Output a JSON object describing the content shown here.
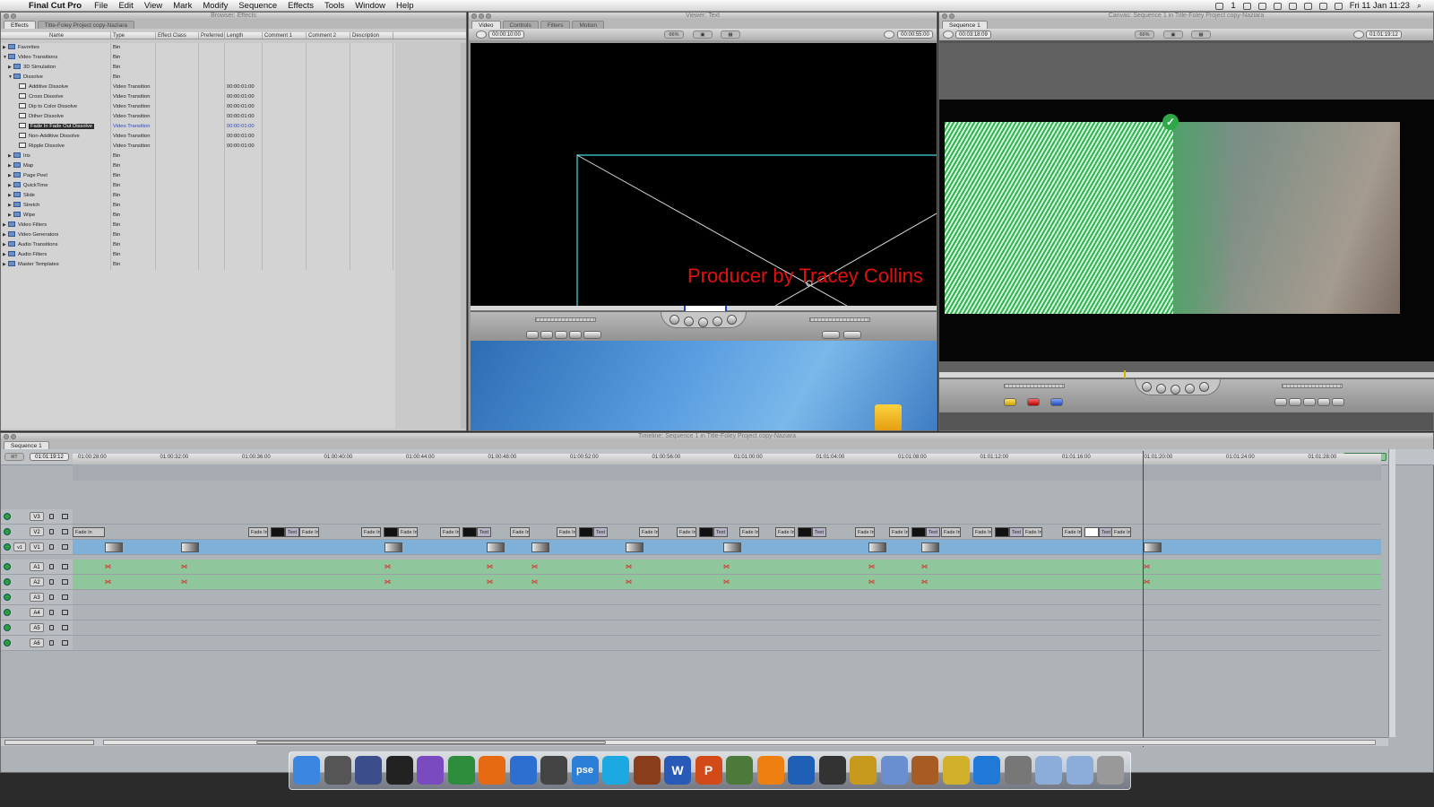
{
  "menubar": {
    "apple": "",
    "app_name": "Final Cut Pro",
    "items": [
      "File",
      "Edit",
      "View",
      "Mark",
      "Modify",
      "Sequence",
      "Effects",
      "Tools",
      "Window",
      "Help"
    ],
    "status_count": "1",
    "datetime": "Fri 11 Jan  11:23"
  },
  "browser": {
    "title": "Browser: Effects",
    "tabs": [
      "Effects",
      "Title-Foley Project copy-Naziara"
    ],
    "columns": [
      "Name",
      "Type",
      "Effect Class",
      "Preferred",
      "Length",
      "Comment 1",
      "Comment 2",
      "Description"
    ],
    "rows": [
      {
        "name": "Favorites",
        "type": "Bin",
        "length": "",
        "level": 0,
        "kind": "bin",
        "tri": "▶"
      },
      {
        "name": "Video Transitions",
        "type": "Bin",
        "length": "",
        "level": 0,
        "kind": "bin",
        "tri": "▼"
      },
      {
        "name": "3D Simulation",
        "type": "Bin",
        "length": "",
        "level": 1,
        "kind": "bin",
        "tri": "▶"
      },
      {
        "name": "Dissolve",
        "type": "Bin",
        "length": "",
        "level": 1,
        "kind": "bin",
        "tri": "▼"
      },
      {
        "name": "Additive Dissolve",
        "type": "Video Transition",
        "length": "00:00:01:00",
        "level": 2,
        "kind": "trans",
        "tri": ""
      },
      {
        "name": "Cross Dissolve",
        "type": "Video Transition",
        "length": "00:00:01:00",
        "level": 2,
        "kind": "trans",
        "tri": ""
      },
      {
        "name": "Dip to Color Dissolve",
        "type": "Video Transition",
        "length": "00:00:01:00",
        "level": 2,
        "kind": "trans",
        "tri": ""
      },
      {
        "name": "Dither Dissolve",
        "type": "Video Transition",
        "length": "00:00:01:00",
        "level": 2,
        "kind": "trans",
        "tri": ""
      },
      {
        "name": "Fade In Fade Out Dissolve",
        "type": "Video Transition",
        "length": "00:00:01:00",
        "level": 2,
        "kind": "trans",
        "tri": "",
        "selected": true
      },
      {
        "name": "Non-Additive Dissolve",
        "type": "Video Transition",
        "length": "00:00:01:00",
        "level": 2,
        "kind": "trans",
        "tri": ""
      },
      {
        "name": "Ripple Dissolve",
        "type": "Video Transition",
        "length": "00:00:01:00",
        "level": 2,
        "kind": "trans",
        "tri": ""
      },
      {
        "name": "Iris",
        "type": "Bin",
        "length": "",
        "level": 1,
        "kind": "bin",
        "tri": "▶"
      },
      {
        "name": "Map",
        "type": "Bin",
        "length": "",
        "level": 1,
        "kind": "bin",
        "tri": "▶"
      },
      {
        "name": "Page Peel",
        "type": "Bin",
        "length": "",
        "level": 1,
        "kind": "bin",
        "tri": "▶"
      },
      {
        "name": "QuickTime",
        "type": "Bin",
        "length": "",
        "level": 1,
        "kind": "bin",
        "tri": "▶"
      },
      {
        "name": "Slide",
        "type": "Bin",
        "length": "",
        "level": 1,
        "kind": "bin",
        "tri": "▶"
      },
      {
        "name": "Stretch",
        "type": "Bin",
        "length": "",
        "level": 1,
        "kind": "bin",
        "tri": "▶"
      },
      {
        "name": "Wipe",
        "type": "Bin",
        "length": "",
        "level": 1,
        "kind": "bin",
        "tri": "▶"
      },
      {
        "name": "Video Filters",
        "type": "Bin",
        "length": "",
        "level": 0,
        "kind": "bin",
        "tri": "▶"
      },
      {
        "name": "Video Generators",
        "type": "Bin",
        "length": "",
        "level": 0,
        "kind": "bin",
        "tri": "▶"
      },
      {
        "name": "Audio Transitions",
        "type": "Bin",
        "length": "",
        "level": 0,
        "kind": "bin",
        "tri": "▶"
      },
      {
        "name": "Audio Filters",
        "type": "Bin",
        "length": "",
        "level": 0,
        "kind": "bin",
        "tri": "▶"
      },
      {
        "name": "Master Templates",
        "type": "Bin",
        "length": "",
        "level": 0,
        "kind": "bin",
        "tri": "▶"
      }
    ]
  },
  "viewer": {
    "title": "Viewer: Text",
    "tabs": [
      "Video",
      "Controls",
      "Filters",
      "Motion"
    ],
    "timecode_left": "00:00:10:00",
    "timecode_right": "00:00:55:00",
    "zoom": "66%",
    "overlay_text": "Producer by Tracey Collins"
  },
  "canvas": {
    "title": "Canvas: Sequence 1 in Title-Foley Project copy-Naziara",
    "tab": "Sequence 1",
    "timecode_left": "00:03:18:09",
    "timecode_right": "01:01:19:12",
    "zoom": "66%"
  },
  "timeline": {
    "title": "Timeline: Sequence 1 in Title-Foley Project copy-Naziara",
    "tab": "Sequence 1",
    "rt": "RT",
    "current_timecode": "01:01:19:12",
    "ruler": [
      "01:00:28:00",
      "01:00:32:00",
      "01:00:36:00",
      "01:00:40:00",
      "01:00:44:00",
      "01:00:48:00",
      "01:00:52:00",
      "01:00:56:00",
      "01:01:00:00",
      "01:01:04:00",
      "01:01:08:00",
      "01:01:12:00",
      "01:01:16:00",
      "01:01:20:00",
      "01:01:24:00",
      "01:01:28:00"
    ],
    "tracks": [
      {
        "name": "V3",
        "patch": ""
      },
      {
        "name": "V2",
        "patch": ""
      },
      {
        "name": "V1",
        "patch": "v1"
      },
      {
        "name": "A1",
        "patch": ""
      },
      {
        "name": "A2",
        "patch": ""
      },
      {
        "name": "A3",
        "patch": ""
      },
      {
        "name": "A4",
        "patch": ""
      },
      {
        "name": "A5",
        "patch": ""
      },
      {
        "name": "A6",
        "patch": ""
      }
    ],
    "fade_label": "Fade In",
    "text_label": "Text"
  },
  "dock": {
    "icons": [
      "finder-icon",
      "clapper-icon",
      "livetype-icon",
      "film-icon",
      "motion-icon",
      "browser-globe-icon",
      "firefox-icon",
      "safari-icon",
      "x-icon",
      "pse-icon",
      "skype-icon",
      "football-icon",
      "word-icon",
      "powerpoint-icon",
      "script-icon",
      "vlc-icon",
      "cyberduck-icon",
      "clapboard-icon",
      "pineapple-icon",
      "itunes-icon",
      "guitar-icon",
      "radiation-icon",
      "quicktime-icon",
      "preferences-icon",
      "applications-folder-icon",
      "documents-folder-icon",
      "trash-icon"
    ],
    "pse_label": "pse",
    "w_label": "W",
    "p_label": "P"
  }
}
